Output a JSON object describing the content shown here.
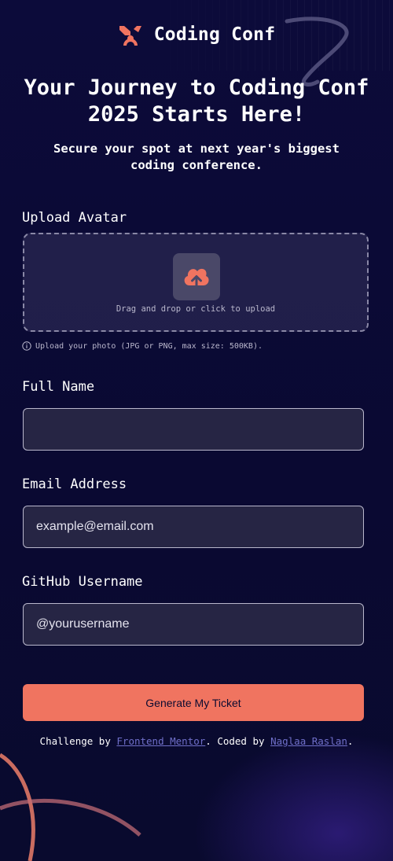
{
  "header": {
    "logo_icon": "coding-conf-logo-icon",
    "logo_text": "Coding Conf"
  },
  "hero": {
    "title": "Your Journey to Coding Conf 2025 Starts Here!",
    "subtitle": "Secure your spot at next year's biggest coding conference."
  },
  "form": {
    "avatar": {
      "label": "Upload Avatar",
      "icon": "upload-cloud-icon",
      "dropzone_text": "Drag and drop or click to upload",
      "hint_icon": "info-icon",
      "hint_text": "Upload your photo (JPG or PNG, max size: 500KB)."
    },
    "full_name": {
      "label": "Full Name",
      "value": "",
      "placeholder": ""
    },
    "email": {
      "label": "Email Address",
      "value": "",
      "placeholder": "example@email.com"
    },
    "github": {
      "label": "GitHub Username",
      "value": "",
      "placeholder": "@yourusername"
    },
    "submit_label": "Generate My Ticket"
  },
  "footer": {
    "prefix": "Challenge by ",
    "link1": "Frontend Mentor",
    "middle": ". Coded by ",
    "link2": "Naglaa Raslan",
    "suffix": "."
  },
  "colors": {
    "background": "#0b0a33",
    "accent": "#f07460",
    "input_background": "#262544",
    "link": "#6f6fc9"
  }
}
